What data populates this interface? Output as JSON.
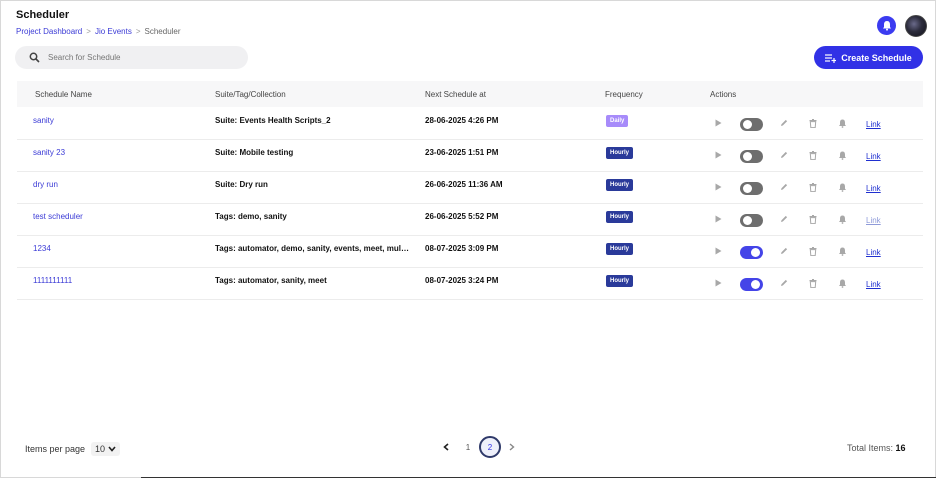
{
  "header": {
    "title": "Scheduler",
    "breadcrumb": [
      "Project Dashboard",
      "Jio Events",
      "Scheduler"
    ]
  },
  "search": {
    "placeholder": "Search for Schedule"
  },
  "create_button": {
    "label": "Create Schedule"
  },
  "table": {
    "columns": [
      "Schedule Name",
      "Suite/Tag/Collection",
      "Next Schedule at",
      "Frequency",
      "Actions"
    ],
    "rows": [
      {
        "name": "sanity",
        "suite": "Suite: Events Health Scripts_2",
        "next": "28-06-2025 4:26 PM",
        "frequency": "Daily",
        "enabled": false,
        "link": "Link",
        "link_muted": false
      },
      {
        "name": "sanity 23",
        "suite": "Suite: Mobile testing",
        "next": "23-06-2025 1:51 PM",
        "frequency": "Hourly",
        "enabled": false,
        "link": "Link",
        "link_muted": false
      },
      {
        "name": "dry run",
        "suite": "Suite: Dry run",
        "next": "26-06-2025 11:36 AM",
        "frequency": "Hourly",
        "enabled": false,
        "link": "Link",
        "link_muted": false
      },
      {
        "name": "test scheduler",
        "suite": "Tags: demo, sanity",
        "next": "26-06-2025 5:52 PM",
        "frequency": "Hourly",
        "enabled": false,
        "link": "Link",
        "link_muted": true
      },
      {
        "name": "1234",
        "suite": "Tags: automator, demo, sanity, events, meet, multi...",
        "next": "08-07-2025 3:09 PM",
        "frequency": "Hourly",
        "enabled": true,
        "link": "Link",
        "link_muted": false
      },
      {
        "name": "1111111111",
        "suite": "Tags: automator, sanity, meet",
        "next": "08-07-2025 3:24 PM",
        "frequency": "Hourly",
        "enabled": true,
        "link": "Link",
        "link_muted": false
      }
    ]
  },
  "footer": {
    "items_per_page_label": "Items per page",
    "items_per_page_value": "10",
    "pages": [
      "1",
      "2"
    ],
    "current_page": "2",
    "total_label": "Total Items:",
    "total_value": "16"
  },
  "colors": {
    "accent": "#3131e6",
    "daily_badge": "#a78bfa",
    "hourly_badge": "#2a3a9a",
    "toggle_on": "#4444e8",
    "toggle_off": "#6e6e6e"
  },
  "icons": [
    "bell-icon",
    "avatar",
    "search-icon",
    "create-schedule-icon",
    "play-icon",
    "edit-icon",
    "delete-icon",
    "notification-icon",
    "chevron-left-icon",
    "chevron-right-icon",
    "chevron-down-icon"
  ]
}
